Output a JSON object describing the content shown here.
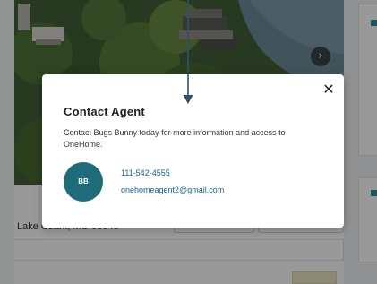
{
  "listing": {
    "address": "Lake Ozark, MO 65049"
  },
  "modal": {
    "title": "Contact Agent",
    "description": "Contact Bugs Bunny today for more information and access to OneHome.",
    "close_glyph": "✕",
    "agent": {
      "initials": "BB",
      "phone": "111-542-4555",
      "email": "onehomeagent2@gmail.com"
    }
  },
  "icons": {
    "close": "close-icon",
    "next": "chevron-right-icon",
    "arrow": "arrow-down-icon"
  },
  "colors": {
    "avatar": "#1e6c7a",
    "link": "#1a5f87",
    "overlay": "rgba(0,0,0,0.40)",
    "accent": "#2e8fa0"
  }
}
